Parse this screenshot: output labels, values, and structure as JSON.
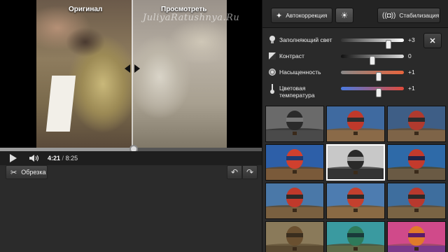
{
  "video": {
    "compare_original_label": "Оригинал",
    "compare_preview_label": "Просмотреть",
    "watermark": "JuliyaRatushnya.Ru",
    "progress_fraction": 0.51,
    "time_current": "4:21",
    "time_separator": "/",
    "time_total": "8:25"
  },
  "edit": {
    "trim_label": "Обрезка",
    "undo_icon": "undo-icon",
    "redo_icon": "redo-icon"
  },
  "toolbar": {
    "auto_label": "Автокоррекция",
    "stab_label": "Стабилизация"
  },
  "sliders": [
    {
      "name": "fill-light",
      "label": "Заполняющий свет",
      "value": "+3",
      "fraction": 0.76,
      "icon": "bulb-icon"
    },
    {
      "name": "contrast",
      "label": "Контраст",
      "value": "0",
      "fraction": 0.5,
      "icon": "contrast-icon"
    },
    {
      "name": "saturation",
      "label": "Насыщенность",
      "value": "+1",
      "fraction": 0.6,
      "icon": "saturation-icon"
    },
    {
      "name": "color-temperature",
      "label": "Цветовая температура",
      "value": "+1",
      "fraction": 0.6,
      "icon": "thermometer-icon"
    }
  ],
  "filters": [
    {
      "sky": "#6a6a6a",
      "ground": "#4a4a4a",
      "hills": "#3a3a3a",
      "balloon": "#2a2a2a",
      "stripe": "#777"
    },
    {
      "sky": "#3f6aa0",
      "ground": "#8a6a48",
      "hills": "#6a5a48",
      "balloon": "#c0392b",
      "stripe": "#2d2d2d"
    },
    {
      "sky": "#3e5e86",
      "ground": "#7e6448",
      "hills": "#5e5040",
      "balloon": "#b03a2e",
      "stripe": "#2b2b2b"
    },
    {
      "sky": "#2d5fa8",
      "ground": "#7a5a3a",
      "hills": "#5a4a3a",
      "balloon": "#d0402e",
      "stripe": "#1f3a70"
    },
    {
      "sky": "#c8c8c8",
      "ground": "#333333",
      "hills": "#555555",
      "balloon": "#2a2a2a",
      "stripe": "#999"
    },
    {
      "sky": "#2e6aa8",
      "ground": "#6a5a44",
      "hills": "#4a4a3a",
      "balloon": "#c43a2c",
      "stripe": "#224"
    },
    {
      "sky": "#4a78a8",
      "ground": "#7a6040",
      "hills": "#5a5040",
      "balloon": "#c0392b",
      "stripe": "#2a2a2a"
    },
    {
      "sky": "#4d7cb0",
      "ground": "#8a6a44",
      "hills": "#6a5a44",
      "balloon": "#c4402e",
      "stripe": "#2a2a2a"
    },
    {
      "sky": "#3e6e9e",
      "ground": "#7a6444",
      "hills": "#5a5244",
      "balloon": "#b8392e",
      "stripe": "#2a2a2a"
    },
    {
      "sky": "#8a7a5a",
      "ground": "#5a4a32",
      "hills": "#6a5a3e",
      "balloon": "#6a5030",
      "stripe": "#3a2e1e"
    },
    {
      "sky": "#3a9aa0",
      "ground": "#5e6a48",
      "hills": "#4a5a44",
      "balloon": "#2e7a5a",
      "stripe": "#1a3a3a"
    },
    {
      "sky": "#d04a8a",
      "ground": "#7a3a8a",
      "hills": "#a04a6a",
      "balloon": "#e07a2a",
      "stripe": "#5a1a6a"
    }
  ],
  "colors": {
    "fill_light_track": "linear-gradient(90deg,#333,#fff)",
    "contrast_track": "linear-gradient(90deg,#111,#ddd)",
    "saturation_track": "linear-gradient(90deg,#888,#e8643c)",
    "temperature_track": "linear-gradient(90deg,#4a7ae0,#e04a3a)"
  }
}
